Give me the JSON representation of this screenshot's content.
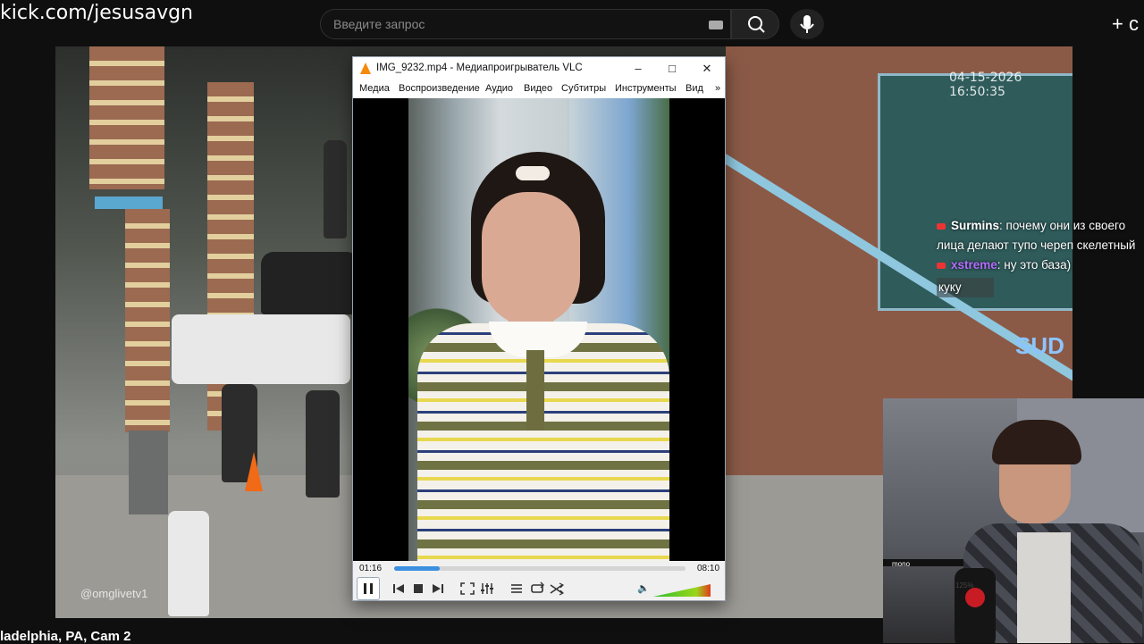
{
  "top": {
    "site_url": "kick.com/jesusavgn",
    "search_placeholder": "Введите запрос",
    "create_label": "+ с"
  },
  "stream": {
    "watermark": "@omglivetv1",
    "timestamp": "04-15-2026 16:50:35",
    "graffiti": "SUD",
    "bottom_title": "ladelphia, PA, Cam 2"
  },
  "chat": {
    "messages": [
      {
        "user": "Surmins",
        "user_color": "#ffffff",
        "text": ": почему они из своего лица делают тупо череп скелетный"
      },
      {
        "user": "xstreme",
        "user_color": "#b46cff",
        "text": ": ну это база)"
      }
    ],
    "pending": "куку"
  },
  "vlc": {
    "title": "IMG_9232.mp4 - Медиапроигрыватель VLC",
    "win_minimize": "–",
    "win_maximize": "□",
    "win_close": "✕",
    "menu": [
      "Медиа",
      "Воспроизведение",
      "Аудио",
      "Видео",
      "Субтитры",
      "Инструменты",
      "Вид",
      "»"
    ],
    "elapsed": "01:16",
    "duration": "08:10",
    "progress": 0.155,
    "volume": "125%",
    "volume_level": 1.25
  },
  "webcam": {
    "mic_label": "mono"
  },
  "icons": {
    "search": "search-icon",
    "mic": "microphone-icon",
    "keyboard": "keyboard-icon",
    "vlc": "vlc-cone-icon",
    "play_pause": "pause-icon"
  }
}
